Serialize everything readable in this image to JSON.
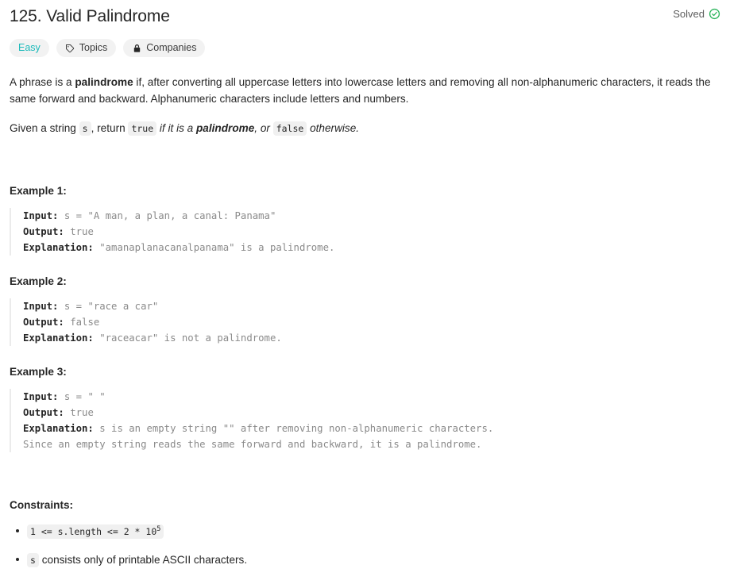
{
  "header": {
    "title": "125. Valid Palindrome",
    "status_label": "Solved",
    "status_icon": "check-circle-icon",
    "status_color": "#2db55d"
  },
  "badges": [
    {
      "label": "Easy",
      "icon": null,
      "color": "#1cbaba",
      "name": "difficulty-badge"
    },
    {
      "label": "Topics",
      "icon": "tag-icon",
      "color": "#3c3c3c",
      "name": "topics-badge"
    },
    {
      "label": "Companies",
      "icon": "lock-icon",
      "color": "#3c3c3c",
      "name": "companies-badge"
    }
  ],
  "description": {
    "paragraph1": {
      "part1": "A phrase is a ",
      "bold1": "palindrome",
      "part2": " if, after converting all uppercase letters into lowercase letters and removing all non-alphanumeric characters, it reads the same forward and backward. Alphanumeric characters include letters and numbers."
    },
    "paragraph2": {
      "part1": "Given a string ",
      "code1": "s",
      "part2": ", return ",
      "code2": "true",
      "italic1": " if it is a ",
      "bolditalic1": "palindrome",
      "italic2": ", or ",
      "code3": "false",
      "italic3": " otherwise."
    }
  },
  "examples": [
    {
      "heading": "Example 1:",
      "input_label": "Input:",
      "input_value": " s = \"A man, a plan, a canal: Panama\"",
      "output_label": "Output:",
      "output_value": " true",
      "explanation_label": "Explanation:",
      "explanation_value": " \"amanaplanacanalpanama\" is a palindrome."
    },
    {
      "heading": "Example 2:",
      "input_label": "Input:",
      "input_value": " s = \"race a car\"",
      "output_label": "Output:",
      "output_value": " false",
      "explanation_label": "Explanation:",
      "explanation_value": " \"raceacar\" is not a palindrome."
    },
    {
      "heading": "Example 3:",
      "input_label": "Input:",
      "input_value": " s = \" \"",
      "output_label": "Output:",
      "output_value": " true",
      "explanation_label": "Explanation:",
      "explanation_value": " s is an empty string \"\" after removing non-alphanumeric characters.\nSince an empty string reads the same forward and backward, it is a palindrome."
    }
  ],
  "constraints": {
    "heading": "Constraints:",
    "items": [
      {
        "code_prefix": "1 <= s.length <= 2 * 10",
        "code_sup": "5",
        "text_suffix": ""
      },
      {
        "code_prefix": "s",
        "code_sup": "",
        "text_suffix": " consists only of printable ASCII characters."
      }
    ]
  }
}
